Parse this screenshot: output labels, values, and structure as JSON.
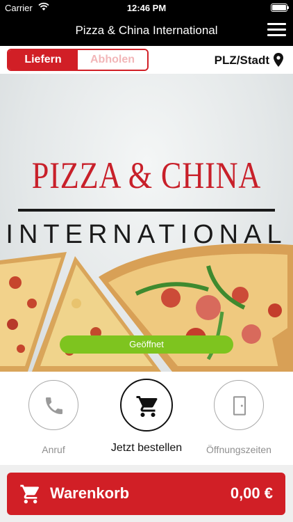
{
  "status_bar": {
    "carrier": "Carrier",
    "time": "12:46 PM"
  },
  "nav": {
    "title": "Pizza & China International",
    "menu_icon": "hamburger-menu-icon"
  },
  "mode_toggle": {
    "options": [
      "Liefern",
      "Abholen"
    ],
    "selected": "Liefern"
  },
  "location": {
    "label": "PLZ/Stadt",
    "icon": "map-pin-icon"
  },
  "hero": {
    "logo_line1": "PIZZA & CHINA",
    "logo_line2": "INTERNATIONAL",
    "status_badge": "Geöffnet"
  },
  "actions": [
    {
      "label": "Anruf",
      "icon": "phone-icon"
    },
    {
      "label": "Jetzt bestellen",
      "icon": "shopping-cart-icon"
    },
    {
      "label": "Öffnungszeiten",
      "icon": "door-icon"
    }
  ],
  "cart": {
    "label": "Warenkorb",
    "total": "0,00 €",
    "icon": "shopping-cart-icon"
  },
  "colors": {
    "brand_red": "#d11f26",
    "open_green": "#7ec41f",
    "nav_black": "#000000"
  }
}
